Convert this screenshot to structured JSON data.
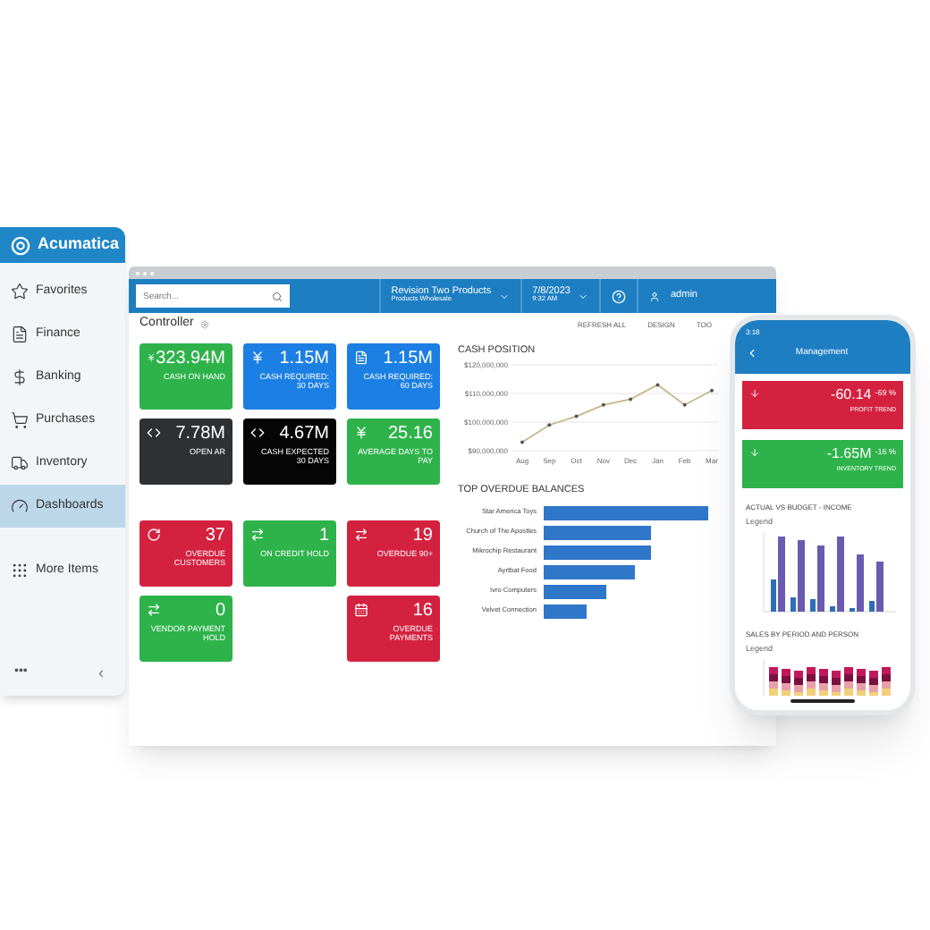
{
  "sidebar": {
    "logo": "Acumatica",
    "items": [
      {
        "label": "Favorites",
        "selected": false
      },
      {
        "label": "Finance",
        "selected": false
      },
      {
        "label": "Banking",
        "selected": false
      },
      {
        "label": "Purchases",
        "selected": false
      },
      {
        "label": "Inventory",
        "selected": false
      },
      {
        "label": "Dashboards",
        "selected": true
      },
      {
        "label": "More Items",
        "selected": false
      }
    ],
    "footer_more": "•••",
    "collapse": "‹"
  },
  "window": {
    "search": {
      "placeholder": "Search..."
    },
    "company": {
      "name": "Revision Two Products",
      "branch": "Products Wholesale"
    },
    "date": {
      "date": "7/8/2023",
      "time": "9:32 AM"
    },
    "user": "admin",
    "page_title": "Controller",
    "actions": [
      "REFRESH ALL",
      "DESIGN",
      "TOO"
    ],
    "tile_groups": [
      [
        {
          "value": "323.94M",
          "label": "CASH ON HAND",
          "color": "#2eb34b"
        },
        {
          "value": "1.15M",
          "label": "CASH REQUIRED: 30 DAYS",
          "color": "#1b7fe3"
        },
        {
          "value": "1.15M",
          "label": "CASH REQUIRED: 60 DAYS",
          "color": "#1b7fe3"
        },
        {
          "value": "7.78M",
          "label": "OPEN AR",
          "color": "#2e3034"
        },
        {
          "value": "4.67M",
          "label": "CASH EXPECTED 30 DAYS",
          "color": "#050505"
        },
        {
          "value": "25.16",
          "label": "AVERAGE DAYS TO PAY",
          "color": "#2eb34b"
        }
      ],
      [
        {
          "value": "37",
          "label": "OVERDUE CUSTOMERS",
          "color": "#d4213f"
        },
        {
          "value": "1",
          "label": "ON CREDIT HOLD",
          "color": "#2eb34b"
        },
        {
          "value": "19",
          "label": "OVERDUE 90+",
          "color": "#d4213f"
        },
        {
          "value": "0",
          "label": "VENDOR PAYMENT HOLD",
          "color": "#2eb34b"
        },
        {
          "value": "16",
          "label": "OVERDUE PAYMENTS",
          "color": "#d4213f"
        }
      ]
    ],
    "cash_position": {
      "title": "CASH POSITION",
      "chart_data": {
        "type": "line",
        "categories": [
          "Aug",
          "Sep",
          "Oct",
          "Nov",
          "Dec",
          "Jan",
          "Feb",
          "Mar"
        ],
        "series": [
          {
            "color": "#c9b48a",
            "values": [
              93000000,
              99000000,
              102000000,
              106000000,
              108000000,
              113000000,
              106000000,
              111000000
            ]
          }
        ],
        "ylim": [
          90000000,
          120000000
        ],
        "yticks": [
          {
            "value": 90000000,
            "label": "$90,000,000"
          },
          {
            "value": 100000000,
            "label": "$100,000,000"
          },
          {
            "value": 110000000,
            "label": "$110,000,000"
          },
          {
            "value": 120000000,
            "label": "$120,000,000"
          }
        ]
      }
    },
    "top_overdue": {
      "title": "TOP OVERDUE BALANCES",
      "rows": [
        {
          "name": "Star America Toys"
        },
        {
          "name": "Church of The Apostles"
        },
        {
          "name": "Mikrochip Restaurant"
        },
        {
          "name": "Ayrtbat Food"
        },
        {
          "name": "Ivro Computers"
        },
        {
          "name": "Velvet Connection"
        }
      ]
    }
  },
  "phone": {
    "time": "3:18",
    "title": "Management",
    "kpis": [
      {
        "value": "-60.14",
        "change": "-69 %",
        "label": "PROFIT TREND",
        "color": "#d4213f"
      },
      {
        "value": "-1.65M",
        "change": "-16 %",
        "label": "INVENTORY TREND",
        "color": "#2eb34b"
      }
    ],
    "charts": [
      {
        "title": "ACTUAL VS BUDGET - INCOME",
        "legend": "Legend",
        "kind": "bars"
      },
      {
        "title": "SALES BY PERIOD AND PERSON",
        "legend": "Legend",
        "kind": "stacked"
      }
    ]
  }
}
